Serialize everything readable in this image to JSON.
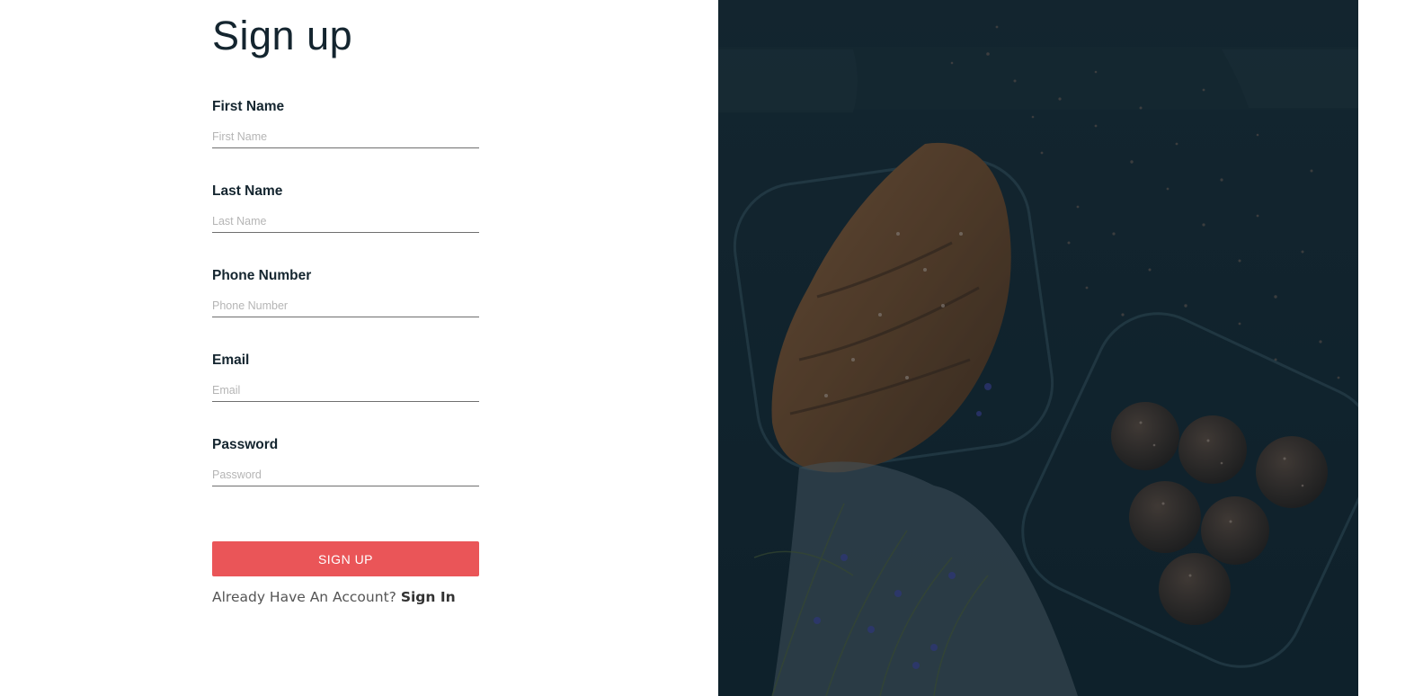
{
  "title": "Sign up",
  "fields": [
    {
      "label": "First Name",
      "placeholder": "First Name"
    },
    {
      "label": "Last Name",
      "placeholder": "Last Name"
    },
    {
      "label": "Phone Number",
      "placeholder": "Phone Number"
    },
    {
      "label": "Email",
      "placeholder": "Email"
    },
    {
      "label": "Password",
      "placeholder": "Password"
    }
  ],
  "signup_button": "SIGN UP",
  "signin_prompt": "Already Have An Account?",
  "signin_link": "Sign In",
  "colors": {
    "accent": "#ea5558",
    "heading": "#14252f",
    "photo_overlay": "#13232d"
  }
}
